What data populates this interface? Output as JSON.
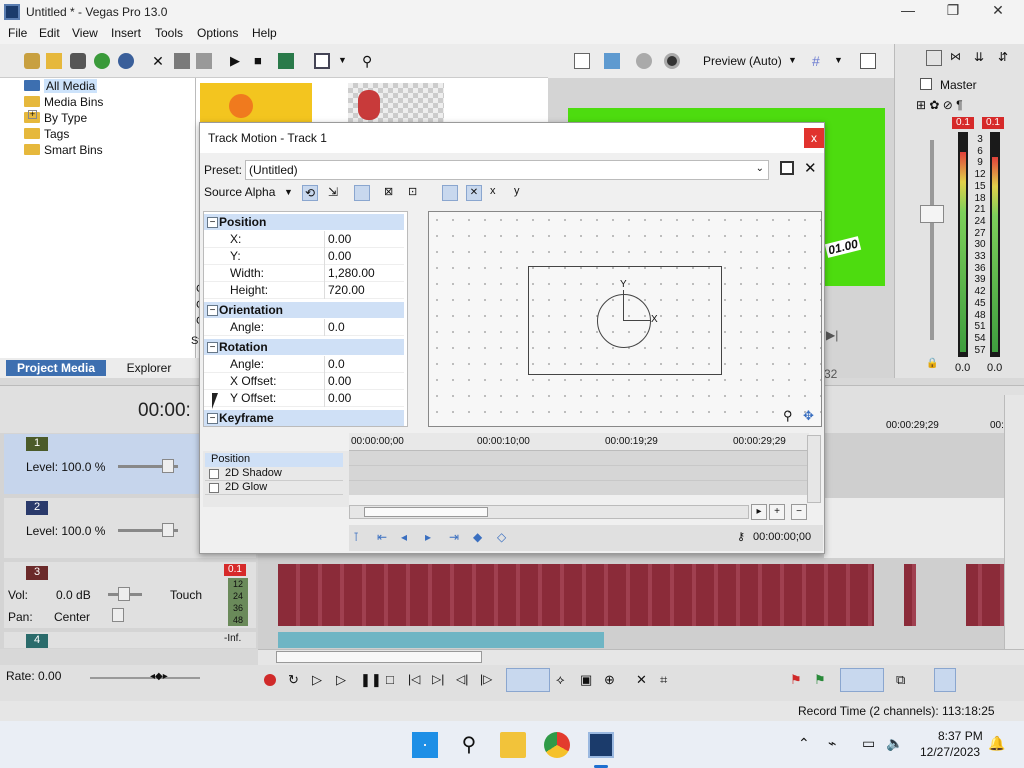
{
  "window": {
    "title": "Untitled * - Vegas Pro 13.0"
  },
  "menu": [
    "File",
    "Edit",
    "View",
    "Insert",
    "Tools",
    "Options",
    "Help"
  ],
  "explorer_tree": [
    "All Media",
    "Media Bins",
    "By Type",
    "Tags",
    "Smart Bins"
  ],
  "expander": "+",
  "bottom_tabs": {
    "project_media": "Project Media",
    "explorer": "Explorer"
  },
  "preview": {
    "mode": "Preview (Auto)",
    "overlay_time": "01.00",
    "side_frag": "32"
  },
  "left_frag": {
    "c1": "C",
    "c2": "C",
    "c3": "C",
    "st": "St"
  },
  "master": {
    "label": "Master",
    "peak_l": "0.1",
    "peak_r": "0.1",
    "scale": [
      "3",
      "6",
      "9",
      "12",
      "15",
      "18",
      "21",
      "24",
      "27",
      "30",
      "33",
      "36",
      "39",
      "42",
      "45",
      "48",
      "51",
      "54",
      "57"
    ],
    "bottom_l": "0.0",
    "bottom_r": "0.0"
  },
  "timeline": {
    "current_time": "00:00:",
    "ruler": [
      "00:00:29;29",
      "00:"
    ]
  },
  "tracks": [
    {
      "num": "1",
      "level": "Level: 100.0 %"
    },
    {
      "num": "2",
      "level": "Level: 100.0 %"
    },
    {
      "num": "3",
      "vol_label": "Vol:",
      "vol": "0.0 dB",
      "pan_label": "Pan:",
      "pan": "Center",
      "mode": "Touch",
      "peak": "0.1",
      "scale": [
        "12",
        "24",
        "36",
        "48"
      ]
    },
    {
      "num": "4",
      "peak": "-Inf."
    }
  ],
  "rate": "Rate: 0.00",
  "dialog": {
    "title": "Track Motion - Track 1",
    "close": "x",
    "preset_label": "Preset:",
    "preset_value": "(Untitled)",
    "source_alpha": "Source Alpha",
    "groups": {
      "position": {
        "label": "Position",
        "rows": [
          [
            "X:",
            "0.00"
          ],
          [
            "Y:",
            "0.00"
          ],
          [
            "Width:",
            "1,280.00"
          ],
          [
            "Height:",
            "720.00"
          ]
        ]
      },
      "orientation": {
        "label": "Orientation",
        "rows": [
          [
            "Angle:",
            "0.0"
          ]
        ]
      },
      "rotation": {
        "label": "Rotation",
        "rows": [
          [
            "Angle:",
            "0.0"
          ],
          [
            "X Offset:",
            "0.00"
          ],
          [
            "Y Offset:",
            "0.00"
          ]
        ]
      },
      "keyframe": {
        "label": "Keyframe"
      }
    },
    "axis": {
      "x": "X",
      "y": "Y"
    },
    "kf_ruler": [
      "00:00:00;00",
      "00:00:10;00",
      "00:00:19;29",
      "00:00:29;29"
    ],
    "kf_tracks": [
      "Position",
      "2D Shadow",
      "2D Glow"
    ],
    "kf_time": "00:00:00;00"
  },
  "status_bar": "Record Time (2 channels): 113:18:25",
  "clock": {
    "time": "8:37 PM",
    "date": "12/27/2023"
  },
  "colors": {
    "wave_audio": "#8b2b39",
    "wave_video": "#6fb5c4",
    "preview_green": "#4ddc0f",
    "accent": "#cfe0f6"
  }
}
